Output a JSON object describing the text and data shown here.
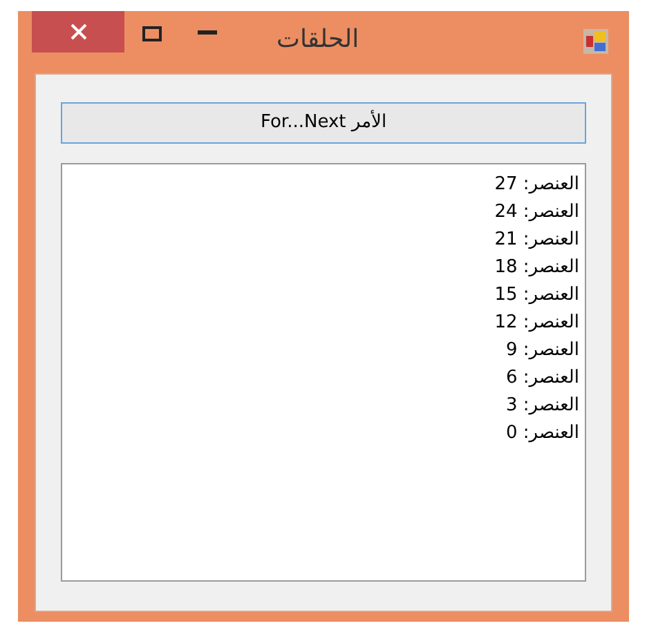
{
  "window": {
    "title": "الحلقات"
  },
  "button": {
    "label": "الأمر For...Next"
  },
  "list": {
    "items": [
      "العنصر: 27",
      "العنصر: 24",
      "العنصر: 21",
      "العنصر: 18",
      "العنصر: 15",
      "العنصر: 12",
      "العنصر: 9",
      "العنصر: 6",
      "العنصر: 3",
      "العنصر: 0"
    ]
  }
}
